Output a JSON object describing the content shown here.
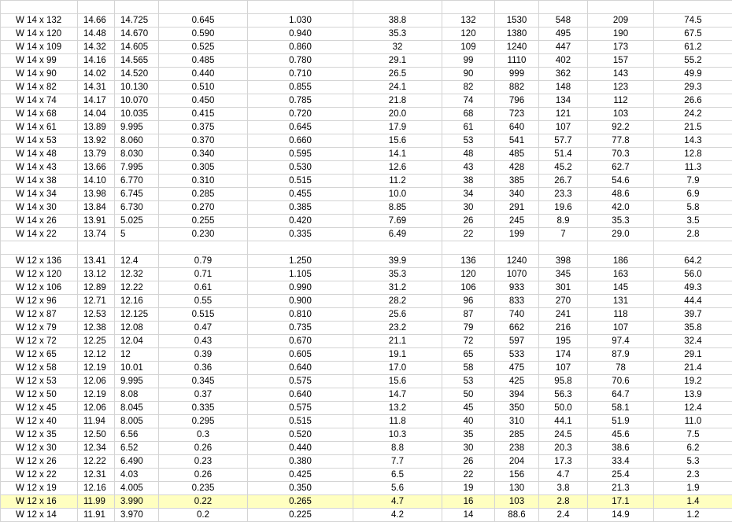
{
  "colors": {
    "grid": "#d4d4d4",
    "highlight": "#ffffc0"
  },
  "section1": [
    [
      "W 14 x 132",
      "14.66",
      "14.725",
      "0.645",
      "1.030",
      "38.8",
      "132",
      "1530",
      "548",
      "209",
      "74.5"
    ],
    [
      "W 14 x 120",
      "14.48",
      "14.670",
      "0.590",
      "0.940",
      "35.3",
      "120",
      "1380",
      "495",
      "190",
      "67.5"
    ],
    [
      "W 14 x 109",
      "14.32",
      "14.605",
      "0.525",
      "0.860",
      "32",
      "109",
      "1240",
      "447",
      "173",
      "61.2"
    ],
    [
      "W 14 x 99",
      "14.16",
      "14.565",
      "0.485",
      "0.780",
      "29.1",
      "99",
      "1110",
      "402",
      "157",
      "55.2"
    ],
    [
      "W 14 x 90",
      "14.02",
      "14.520",
      "0.440",
      "0.710",
      "26.5",
      "90",
      "999",
      "362",
      "143",
      "49.9"
    ],
    [
      "W 14 x 82",
      "14.31",
      "10.130",
      "0.510",
      "0.855",
      "24.1",
      "82",
      "882",
      "148",
      "123",
      "29.3"
    ],
    [
      "W 14 x 74",
      "14.17",
      "10.070",
      "0.450",
      "0.785",
      "21.8",
      "74",
      "796",
      "134",
      "112",
      "26.6"
    ],
    [
      "W 14 x 68",
      "14.04",
      "10.035",
      "0.415",
      "0.720",
      "20.0",
      "68",
      "723",
      "121",
      "103",
      "24.2"
    ],
    [
      "W 14 x 61",
      "13.89",
      "9.995",
      "0.375",
      "0.645",
      "17.9",
      "61",
      "640",
      "107",
      "92.2",
      "21.5"
    ],
    [
      "W 14 x 53",
      "13.92",
      "8.060",
      "0.370",
      "0.660",
      "15.6",
      "53",
      "541",
      "57.7",
      "77.8",
      "14.3"
    ],
    [
      "W 14 x 48",
      "13.79",
      "8.030",
      "0.340",
      "0.595",
      "14.1",
      "48",
      "485",
      "51.4",
      "70.3",
      "12.8"
    ],
    [
      "W 14 x 43",
      "13.66",
      "7.995",
      "0.305",
      "0.530",
      "12.6",
      "43",
      "428",
      "45.2",
      "62.7",
      "11.3"
    ],
    [
      "W 14 x 38",
      "14.10",
      "6.770",
      "0.310",
      "0.515",
      "11.2",
      "38",
      "385",
      "26.7",
      "54.6",
      "7.9"
    ],
    [
      "W 14 x 34",
      "13.98",
      "6.745",
      "0.285",
      "0.455",
      "10.0",
      "34",
      "340",
      "23.3",
      "48.6",
      "6.9"
    ],
    [
      "W 14 x 30",
      "13.84",
      "6.730",
      "0.270",
      "0.385",
      "8.85",
      "30",
      "291",
      "19.6",
      "42.0",
      "5.8"
    ],
    [
      "W 14 x 26",
      "13.91",
      "5.025",
      "0.255",
      "0.420",
      "7.69",
      "26",
      "245",
      "8.9",
      "35.3",
      "3.5"
    ],
    [
      "W 14 x 22",
      "13.74",
      "5",
      "0.230",
      "0.335",
      "6.49",
      "22",
      "199",
      "7",
      "29.0",
      "2.8"
    ]
  ],
  "section2": [
    [
      "W 12 x 136",
      "13.41",
      "12.4",
      "0.79",
      "1.250",
      "39.9",
      "136",
      "1240",
      "398",
      "186",
      "64.2"
    ],
    [
      "W 12 x 120",
      "13.12",
      "12.32",
      "0.71",
      "1.105",
      "35.3",
      "120",
      "1070",
      "345",
      "163",
      "56.0"
    ],
    [
      "W 12 x 106",
      "12.89",
      "12.22",
      "0.61",
      "0.990",
      "31.2",
      "106",
      "933",
      "301",
      "145",
      "49.3"
    ],
    [
      "W 12 x 96",
      "12.71",
      "12.16",
      "0.55",
      "0.900",
      "28.2",
      "96",
      "833",
      "270",
      "131",
      "44.4"
    ],
    [
      "W 12 x 87",
      "12.53",
      "12.125",
      "0.515",
      "0.810",
      "25.6",
      "87",
      "740",
      "241",
      "118",
      "39.7"
    ],
    [
      "W 12 x 79",
      "12.38",
      "12.08",
      "0.47",
      "0.735",
      "23.2",
      "79",
      "662",
      "216",
      "107",
      "35.8"
    ],
    [
      "W 12 x 72",
      "12.25",
      "12.04",
      "0.43",
      "0.670",
      "21.1",
      "72",
      "597",
      "195",
      "97.4",
      "32.4"
    ],
    [
      "W 12 x 65",
      "12.12",
      "12",
      "0.39",
      "0.605",
      "19.1",
      "65",
      "533",
      "174",
      "87.9",
      "29.1"
    ],
    [
      "W 12 x 58",
      "12.19",
      "10.01",
      "0.36",
      "0.640",
      "17.0",
      "58",
      "475",
      "107",
      "78",
      "21.4"
    ],
    [
      "W 12 x 53",
      "12.06",
      "9.995",
      "0.345",
      "0.575",
      "15.6",
      "53",
      "425",
      "95.8",
      "70.6",
      "19.2"
    ],
    [
      "W 12 x 50",
      "12.19",
      "8.08",
      "0.37",
      "0.640",
      "14.7",
      "50",
      "394",
      "56.3",
      "64.7",
      "13.9"
    ],
    [
      "W 12 x 45",
      "12.06",
      "8.045",
      "0.335",
      "0.575",
      "13.2",
      "45",
      "350",
      "50.0",
      "58.1",
      "12.4"
    ],
    [
      "W 12 x 40",
      "11.94",
      "8.005",
      "0.295",
      "0.515",
      "11.8",
      "40",
      "310",
      "44.1",
      "51.9",
      "11.0"
    ],
    [
      "W 12 x 35",
      "12.50",
      "6.56",
      "0.3",
      "0.520",
      "10.3",
      "35",
      "285",
      "24.5",
      "45.6",
      "7.5"
    ],
    [
      "W 12 x 30",
      "12.34",
      "6.52",
      "0.26",
      "0.440",
      "8.8",
      "30",
      "238",
      "20.3",
      "38.6",
      "6.2"
    ],
    [
      "W 12 x 26",
      "12.22",
      "6.490",
      "0.23",
      "0.380",
      "7.7",
      "26",
      "204",
      "17.3",
      "33.4",
      "5.3"
    ],
    [
      "W 12 x 22",
      "12.31",
      "4.03",
      "0.26",
      "0.425",
      "6.5",
      "22",
      "156",
      "4.7",
      "25.4",
      "2.3"
    ],
    [
      "W 12 x 19",
      "12.16",
      "4.005",
      "0.235",
      "0.350",
      "5.6",
      "19",
      "130",
      "3.8",
      "21.3",
      "1.9"
    ],
    [
      "W 12 x 16",
      "11.99",
      "3.990",
      "0.22",
      "0.265",
      "4.7",
      "16",
      "103",
      "2.8",
      "17.1",
      "1.4"
    ],
    [
      "W 12 x 14",
      "11.91",
      "3.970",
      "0.2",
      "0.225",
      "4.2",
      "14",
      "88.6",
      "2.4",
      "14.9",
      "1.2"
    ]
  ],
  "highlighted_row": "W 12 x 16"
}
